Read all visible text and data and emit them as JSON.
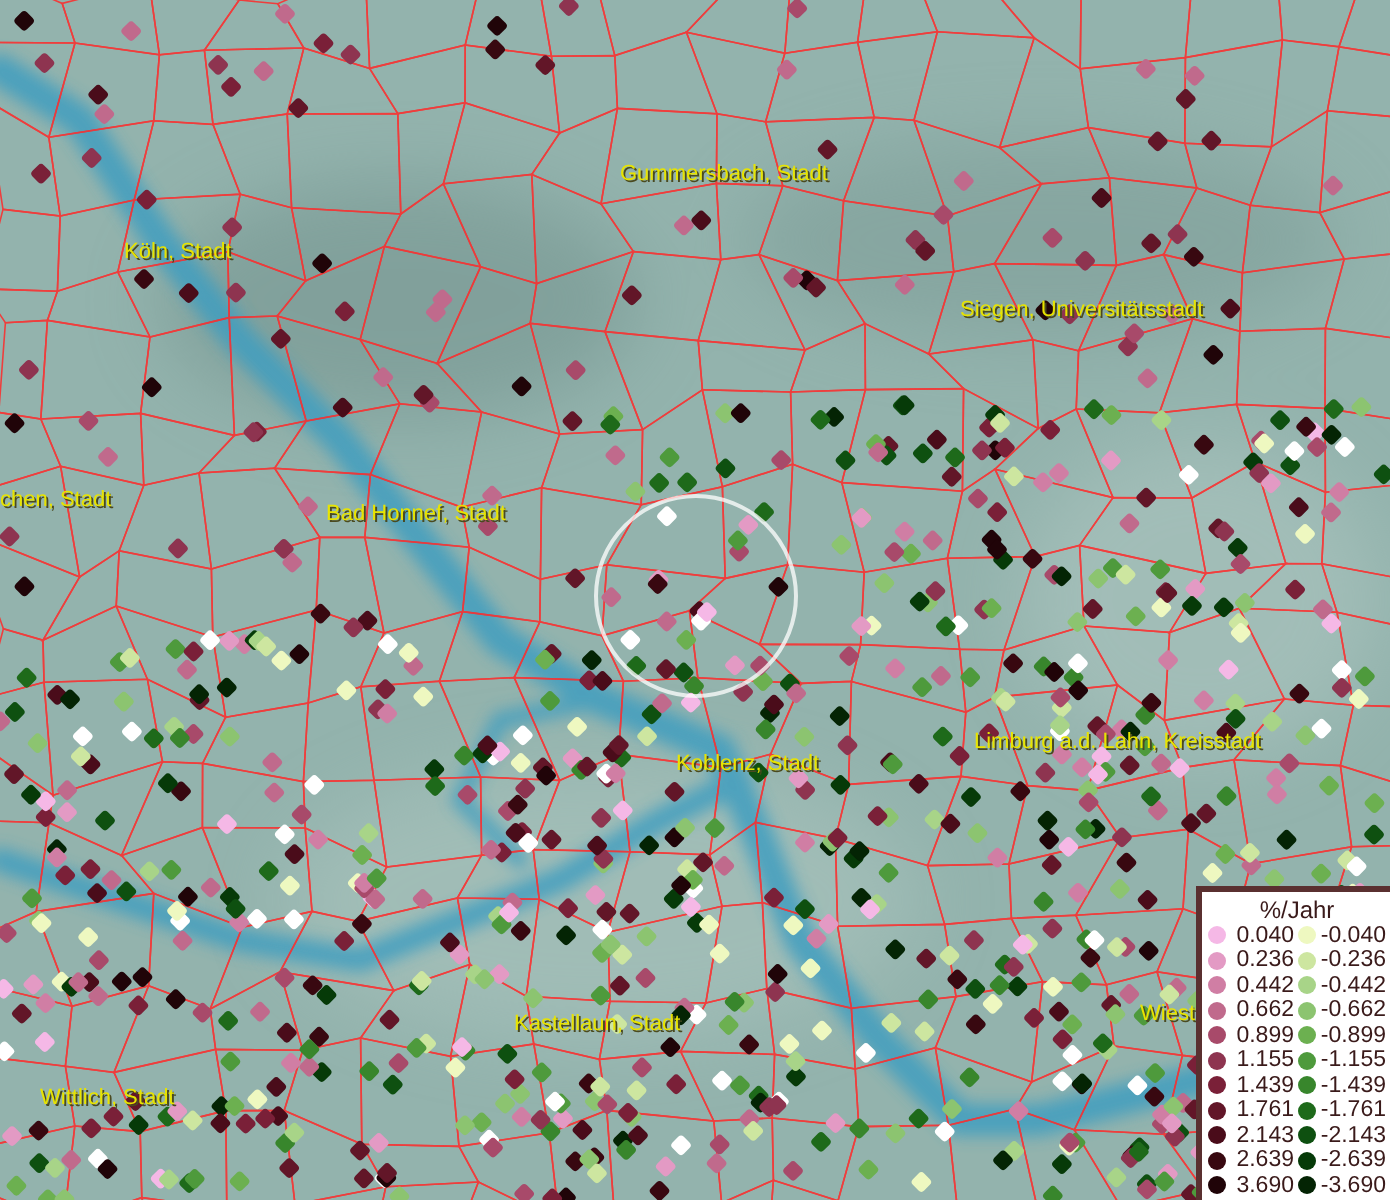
{
  "map": {
    "cities": [
      {
        "label": "Gummersbach, Stadt"
      },
      {
        "label": "Köln, Stadt"
      },
      {
        "label": "Siegen, Universitätsstadt"
      },
      {
        "label": "chen, Stadt"
      },
      {
        "label": "Bad Honnef, Stadt"
      },
      {
        "label": "Limburg a.d. Lahn, Kreisstadt"
      },
      {
        "label": "Koblenz, Stadt"
      },
      {
        "label": "Kastellaun, Stadt"
      },
      {
        "label": "Wittlich, Stadt"
      },
      {
        "label": "Wiest"
      }
    ]
  },
  "legend": {
    "title": "%/Jahr",
    "positive": [
      {
        "value": "0.040",
        "color": "#f5b8e6"
      },
      {
        "value": "0.236",
        "color": "#e39ac4"
      },
      {
        "value": "0.442",
        "color": "#d07ea4"
      },
      {
        "value": "0.662",
        "color": "#c06a8c"
      },
      {
        "value": "0.899",
        "color": "#a84a6a"
      },
      {
        "value": "1.155",
        "color": "#8e3450"
      },
      {
        "value": "1.439",
        "color": "#7a2038"
      },
      {
        "value": "1.761",
        "color": "#621628"
      },
      {
        "value": "2.143",
        "color": "#4a0c1a"
      },
      {
        "value": "2.639",
        "color": "#380810"
      },
      {
        "value": "3.690",
        "color": "#200408"
      }
    ],
    "negative": [
      {
        "value": "-0.040",
        "color": "#eef8c0"
      },
      {
        "value": "-0.236",
        "color": "#cde6a0"
      },
      {
        "value": "-0.442",
        "color": "#a8d488"
      },
      {
        "value": "-0.662",
        "color": "#8cc470"
      },
      {
        "value": "-0.899",
        "color": "#6cb050"
      },
      {
        "value": "-1.155",
        "color": "#4e9a3c"
      },
      {
        "value": "-1.439",
        "color": "#38862c"
      },
      {
        "value": "-1.761",
        "color": "#1e6a1a"
      },
      {
        "value": "-2.143",
        "color": "#0e5010"
      },
      {
        "value": "-2.639",
        "color": "#063a08"
      },
      {
        "value": "-3.690",
        "color": "#042404"
      }
    ]
  }
}
